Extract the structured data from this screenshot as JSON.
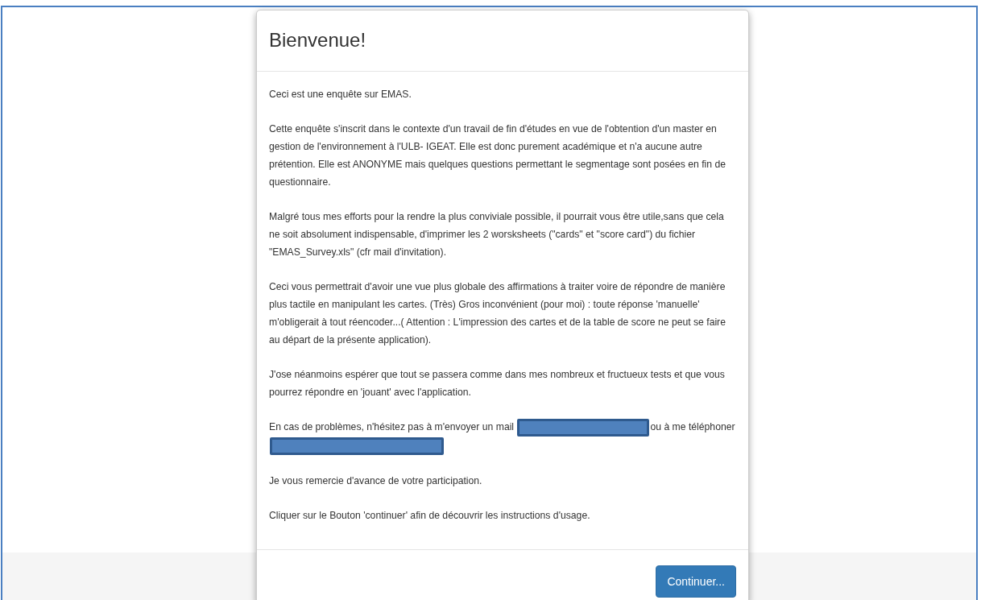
{
  "dialog": {
    "title": "Bienvenue!",
    "paragraphs": [
      {
        "segments": [
          {
            "kind": "text",
            "text": "Ceci est une enquête sur EMAS."
          }
        ]
      },
      {
        "segments": [
          {
            "kind": "text",
            "text": "Cette enquête s'inscrit dans le contexte d'un travail de fin d'études en vue de l'obtention d'un master en gestion de l'environnement à l'ULB- IGEAT. Elle est donc purement académique et n'a aucune autre prétention. Elle est ANONYME mais quelques questions permettant le segmentage sont posées en fin de questionnaire."
          }
        ]
      },
      {
        "segments": [
          {
            "kind": "text",
            "text": "Malgré tous mes efforts pour la rendre la plus conviviale possible, il pourrait vous être utile,sans que cela ne soit absolument indispensable, d'imprimer les 2 worsksheets (\"cards\" et \"score card\") du fichier \"EMAS_Survey.xls\" (cfr mail d'invitation)."
          }
        ]
      },
      {
        "segments": [
          {
            "kind": "text",
            "text": "Ceci vous permettrait d'avoir une vue plus globale des affirmations à traiter voire de répondre de manière plus tactile en manipulant les cartes. (Très) Gros inconvénient (pour moi) : toute réponse 'manuelle' m'obligerait à tout réencoder...( Attention : L'impression des cartes et de la table de score ne peut se faire au départ de la présente application)."
          }
        ]
      },
      {
        "segments": [
          {
            "kind": "text",
            "text": "J'ose néanmoins espérer que tout se passera comme dans mes nombreux et fructueux tests et que vous pourrez répondre en 'jouant' avec l'application."
          }
        ]
      },
      {
        "segments": [
          {
            "kind": "text",
            "text": "En cas de problèmes, n'hésitez pas à m'envoyer un mail"
          },
          {
            "kind": "redacted"
          },
          {
            "kind": "text",
            "text": "ou à me"
          },
          {
            "kind": "text",
            "text": "téléphoner"
          },
          {
            "kind": "redacted"
          }
        ]
      },
      {
        "segments": [
          {
            "kind": "text",
            "text": "Je vous remercie d'avance de votre participation."
          }
        ]
      },
      {
        "segments": [
          {
            "kind": "text",
            "text": "Cliquer sur le Bouton 'continuer' afin de découvrir les instructions d'usage."
          }
        ]
      }
    ],
    "button": "Continuer..."
  }
}
